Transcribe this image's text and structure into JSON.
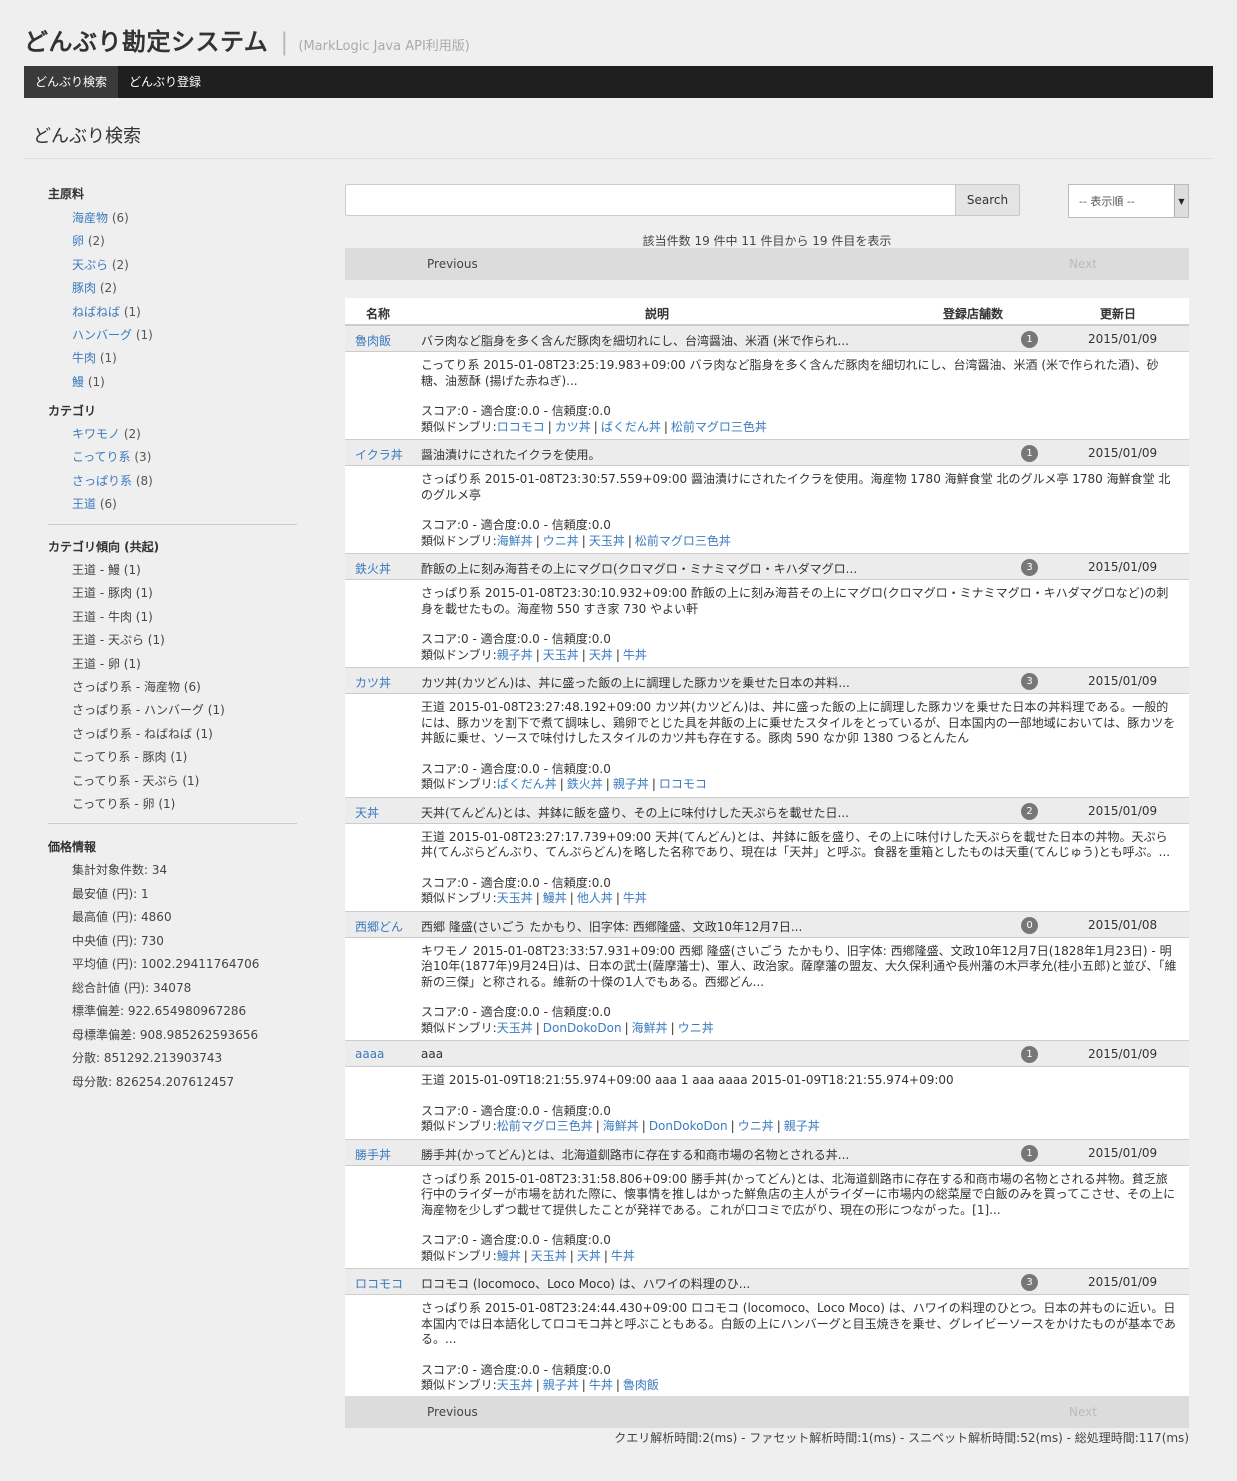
{
  "header": {
    "title": "どんぶり勘定システム",
    "separator": "|",
    "subtitle": "(MarkLogic Java API利用版)"
  },
  "nav": [
    {
      "label": "どんぶり検索",
      "active": true
    },
    {
      "label": "どんぶり登録",
      "active": false
    }
  ],
  "page_title": "どんぶり検索",
  "facets": {
    "main_ingredient": {
      "title": "主原料",
      "items": [
        {
          "label": "海産物",
          "count": "(6)"
        },
        {
          "label": "卵",
          "count": "(2)"
        },
        {
          "label": "天ぷら",
          "count": "(2)"
        },
        {
          "label": "豚肉",
          "count": "(2)"
        },
        {
          "label": "ねばねば",
          "count": "(1)"
        },
        {
          "label": "ハンバーグ",
          "count": "(1)"
        },
        {
          "label": "牛肉",
          "count": "(1)"
        },
        {
          "label": "鰻",
          "count": "(1)"
        }
      ]
    },
    "category": {
      "title": "カテゴリ",
      "items": [
        {
          "label": "キワモノ",
          "count": "(2)"
        },
        {
          "label": "こってり系",
          "count": "(3)"
        },
        {
          "label": "さっぱり系",
          "count": "(8)"
        },
        {
          "label": "王道",
          "count": "(6)"
        }
      ]
    },
    "cooccurrence": {
      "title": "カテゴリ傾向 (共起)",
      "items": [
        "王道 - 鰻 (1)",
        "王道 - 豚肉 (1)",
        "王道 - 牛肉 (1)",
        "王道 - 天ぷら (1)",
        "王道 - 卵 (1)",
        "さっぱり系 - 海産物 (6)",
        "さっぱり系 - ハンバーグ (1)",
        "さっぱり系 - ねばねば (1)",
        "こってり系 - 豚肉 (1)",
        "こってり系 - 天ぷら (1)",
        "こってり系 - 卵 (1)"
      ]
    },
    "price": {
      "title": "価格情報",
      "items": [
        "集計対象件数: 34",
        "最安値 (円): 1",
        "最高値 (円): 4860",
        "中央値 (円): 730",
        "平均値 (円): 1002.29411764706",
        "総合計値 (円): 34078",
        "標準偏差: 922.654980967286",
        "母標準偏差: 908.985262593656",
        "分散: 851292.213903743",
        "母分散: 826254.207612457"
      ]
    }
  },
  "search": {
    "placeholder": "",
    "button_label": "Search",
    "sort_label": "-- 表示順 --"
  },
  "result_summary": "該当件数 19 件中 11 件目から 19 件目を表示",
  "pager": {
    "prev": "Previous",
    "next": "Next"
  },
  "table": {
    "headers": {
      "name": "名称",
      "description": "説明",
      "stores": "登録店舗数",
      "updated": "更新日"
    },
    "score_line": "スコア:0 - 適合度:0.0 - 信頼度:0.0",
    "related_prefix": "類似ドンブリ:",
    "rows": [
      {
        "name": "魯肉飯",
        "summary": "バラ肉など脂身を多く含んだ豚肉を細切れにし、台湾醤油、米酒 (米で作られ...",
        "stores": "1",
        "date": "2015/01/09",
        "snippet": "こってり系 2015-01-08T23:25:19.983+09:00 バラ肉など脂身を多く含んだ豚肉を細切れにし、台湾醤油、米酒 (米で作られた酒)、砂糖、油葱酥 (揚げた赤ねぎ)...",
        "related": [
          "ロコモコ",
          "カツ丼",
          "ばくだん丼",
          "松前マグロ三色丼"
        ]
      },
      {
        "name": "イクラ丼",
        "summary": "醤油漬けにされたイクラを使用。",
        "stores": "1",
        "date": "2015/01/09",
        "snippet": "さっぱり系 2015-01-08T23:30:57.559+09:00 醤油漬けにされたイクラを使用。海産物 1780 海鮮食堂 北のグルメ亭 1780 海鮮食堂 北のグルメ亭",
        "related": [
          "海鮮丼",
          "ウニ丼",
          "天玉丼",
          "松前マグロ三色丼"
        ]
      },
      {
        "name": "鉄火丼",
        "summary": "酢飯の上に刻み海苔その上にマグロ(クロマグロ・ミナミマグロ・キハダマグロ...",
        "stores": "3",
        "date": "2015/01/09",
        "snippet": "さっぱり系 2015-01-08T23:30:10.932+09:00 酢飯の上に刻み海苔その上にマグロ(クロマグロ・ミナミマグロ・キハダマグロなど)の刺身を載せたもの。海産物 550 すき家 730 やよい軒",
        "related": [
          "親子丼",
          "天玉丼",
          "天丼",
          "牛丼"
        ]
      },
      {
        "name": "カツ丼",
        "summary": "カツ丼(カツどん)は、丼に盛った飯の上に調理した豚カツを乗せた日本の丼料...",
        "stores": "3",
        "date": "2015/01/09",
        "snippet": "王道 2015-01-08T23:27:48.192+09:00 カツ丼(カツどん)は、丼に盛った飯の上に調理した豚カツを乗せた日本の丼料理である。一般的には、豚カツを割下で煮て調味し、鶏卵でとじた具を丼飯の上に乗せたスタイルをとっているが、日本国内の一部地域においては、豚カツを丼飯に乗せ、ソースで味付けしたスタイルのカツ丼も存在する。豚肉 590 なか卯 1380 つるとんたん",
        "related": [
          "ばくだん丼",
          "鉄火丼",
          "親子丼",
          "ロコモコ"
        ]
      },
      {
        "name": "天丼",
        "summary": "天丼(てんどん)とは、丼鉢に飯を盛り、その上に味付けした天ぷらを載せた日...",
        "stores": "2",
        "date": "2015/01/09",
        "snippet": "王道 2015-01-08T23:27:17.739+09:00 天丼(てんどん)とは、丼鉢に飯を盛り、その上に味付けした天ぷらを載せた日本の丼物。天ぷら丼(てんぷらどんぶり、てんぷらどん)を略した名称であり、現在は「天丼」と呼ぶ。食器を重箱としたものは天重(てんじゅう)とも呼ぶ。...",
        "related": [
          "天玉丼",
          "鰻丼",
          "他人丼",
          "牛丼"
        ]
      },
      {
        "name": "西郷どん",
        "summary": "西郷 隆盛(さいごう たかもり、旧字体: 西鄕隆盛、文政10年12月7日...",
        "stores": "0",
        "date": "2015/01/08",
        "snippet": "キワモノ 2015-01-08T23:33:57.931+09:00 西郷 隆盛(さいごう たかもり、旧字体: 西鄕隆盛、文政10年12月7日(1828年1月23日) - 明治10年(1877年)9月24日)は、日本の武士(薩摩藩士)、軍人、政治家。薩摩藩の盟友、大久保利通や長州藩の木戸孝允(桂小五郎)と並び、「維新の三傑」と称される。維新の十傑の1人でもある。西郷どん...",
        "related": [
          "天玉丼",
          "DonDokoDon",
          "海鮮丼",
          "ウニ丼"
        ]
      },
      {
        "name": "aaaa",
        "summary": "aaa",
        "stores": "1",
        "date": "2015/01/09",
        "snippet": "王道 2015-01-09T18:21:55.974+09:00 aaa 1 aaa aaaa 2015-01-09T18:21:55.974+09:00",
        "related": [
          "松前マグロ三色丼",
          "海鮮丼",
          "DonDokoDon",
          "ウニ丼",
          "親子丼"
        ]
      },
      {
        "name": "勝手丼",
        "summary": "勝手丼(かってどん)とは、北海道釧路市に存在する和商市場の名物とされる丼...",
        "stores": "1",
        "date": "2015/01/09",
        "snippet": "さっぱり系 2015-01-08T23:31:58.806+09:00 勝手丼(かってどん)とは、北海道釧路市に存在する和商市場の名物とされる丼物。貧乏旅行中のライダーが市場を訪れた際に、懐事情を推しはかった鮮魚店の主人がライダーに市場内の総菜屋で白飯のみを買ってこさせ、その上に海産物を少しずつ載せて提供したことが発祥である。これが口コミで広がり、現在の形につながった。[1]...",
        "related": [
          "鰻丼",
          "天玉丼",
          "天丼",
          "牛丼"
        ]
      },
      {
        "name": "ロコモコ",
        "summary": "ロコモコ (locomoco、Loco Moco) は、ハワイの料理のひ...",
        "stores": "3",
        "date": "2015/01/09",
        "snippet": "さっぱり系 2015-01-08T23:24:44.430+09:00 ロコモコ (locomoco、Loco Moco) は、ハワイの料理のひとつ。日本の丼ものに近い。日本国内では日本語化してロコモコ丼と呼ぶこともある。白飯の上にハンバーグと目玉焼きを乗せ、グレイビーソースをかけたものが基本である。...",
        "related": [
          "天玉丼",
          "親子丼",
          "牛丼",
          "魯肉飯"
        ]
      }
    ]
  },
  "timing": "クエリ解析時間:2(ms) - ファセット解析時間:1(ms) - スニペット解析時間:52(ms) - 総処理時間:117(ms)"
}
